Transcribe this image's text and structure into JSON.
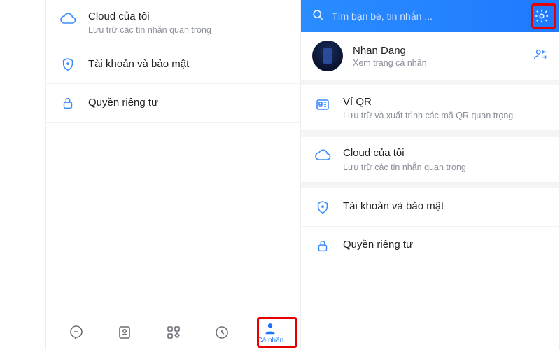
{
  "left": {
    "items": [
      {
        "icon": "cloud",
        "title": "Cloud của tôi",
        "sub": "Lưu trữ các tin nhắn quan trọng"
      },
      {
        "icon": "shield",
        "title": "Tài khoản và bảo mật"
      },
      {
        "icon": "lock",
        "title": "Quyền riêng tư"
      }
    ],
    "nav": {
      "profile_label": "Cá nhân"
    }
  },
  "right": {
    "search_placeholder": "Tìm bạn bè, tin nhắn ...",
    "profile": {
      "name": "Nhan Dang",
      "link": "Xem trang cá nhân"
    },
    "items": [
      {
        "icon": "qr",
        "title": "Ví QR",
        "sub": "Lưu trữ và xuất trình các mã QR quan trọng"
      },
      {
        "icon": "cloud",
        "title": "Cloud của tôi",
        "sub": "Lưu trữ các tin nhắn quan trọng"
      },
      {
        "icon": "shield",
        "title": "Tài khoản và bảo mật"
      },
      {
        "icon": "lock",
        "title": "Quyền riêng tư"
      }
    ]
  },
  "colors": {
    "accent": "#2a8cff",
    "icon_blue": "#3a8bff"
  }
}
